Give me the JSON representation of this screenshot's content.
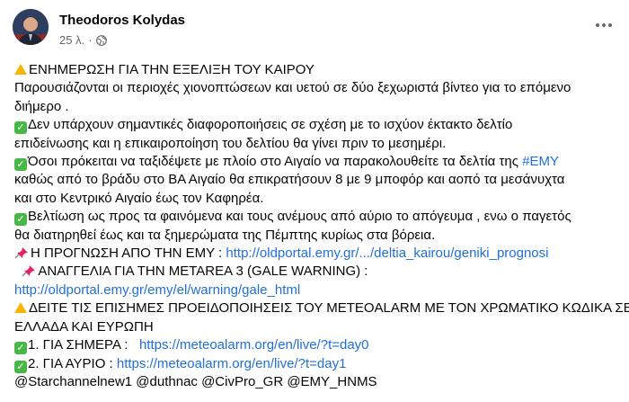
{
  "post": {
    "author": "Theodoros Kolydas",
    "time": "25 λ.",
    "visibility_icon": "globe-icon",
    "menu_icon": "more-options-icon"
  },
  "lines": {
    "l1": "ΕΝΗΜΕΡΩΣΗ ΓΙΑ ΤΗΝ ΕΞΕΛΙΞΗ ΤΟΥ ΚΑΙΡΟΥ",
    "l2": "Παρουσιάζονται οι περιοχές χιονοπτώσεων και υετού σε δύο ξεχωριστά βίντεο για το επόμενο",
    "l3": "διήμερο .",
    "l4": "Δεν υπάρχουν σημαντικές διαφοροποιήσεις σε σχέση με το ισχύον έκτακτο δελτίο",
    "l5": "επιδείνωσης και η επικαιροποίηση του δελτίου θα γίνει πριν το μεσημέρι.",
    "l6a": "Όσοι πρόκειται να ταξιδέψετε με πλοίο στο Αιγαίο να παρακολουθείτε τα δελτία της ",
    "l6tag": "#ΕΜΥ",
    "l7": "καθώς από το βράδυ στο ΒΑ Αιγαίο θα επικρατήσουν 8 με 9 μποφόρ και αοπό τα μεσάνυχτα",
    "l8": "και στο Κεντρικό Αιγαίο έως τον Καφηρέα.",
    "l9": "Βελτίωση ως προς τα φαινόμενα και τους ανέμους από αύριο το απόγευμα , ενω ο παγετός",
    "l10": "θα διατηρηθεί έως και τα ξημερώματα της Πέμπτης κυρίως στα βόρεια.",
    "l11a": "Η ΠΡΟΓΝΩΣΗ ΑΠΟ ΤΗΝ ΕΜΥ : ",
    "l11link": "http://oldportal.emy.gr/.../deltia_kairou/geniki_prognosi",
    "l12": "ΑΝΑΓΓΕΛΙΑ ΓΙΑ ΤΗΝ ΜΕTAREA 3 (GALE WARNING) :",
    "l13link": "http://oldportal.emy.gr/emy/el/warning/gale_html",
    "l14": "ΔΕΙΤΕ ΤΙΣ ΕΠΙΣΗΜΕΣ ΠΡΟΕΙΔΟΠΟΙΗΣΕΙΣ ΤΟΥ  METEOALARM ΜΕ ΤΟΝ ΧΡΩΜΑΤΙΚΟ ΚΩΔΙΚΑ ΣΕ",
    "l15": "ΕΛΛΑΔΑ ΚΑΙ ΕΥΡΩΠΗ",
    "l16a": "1. ΓΙΑ ΣΗΜΕΡΑ :   ",
    "l16link": "https://meteoalarm.org/en/live/?t=day0",
    "l17a": "2. ΓΙΑ ΑΥΡΙΟ : ",
    "l17link": "https://meteoalarm.org/en/live/?t=day1",
    "l18": "@Starchannelnew1 @duthnac @CivPro_GR @EMY_HNMS"
  },
  "icons": {
    "warning": "warning-icon",
    "check": "check-mark-icon",
    "pin": "pushpin-icon"
  },
  "colors": {
    "link": "#216fdb",
    "meta": "#65676b",
    "check": "#47b847",
    "warning": "#f7b500"
  }
}
